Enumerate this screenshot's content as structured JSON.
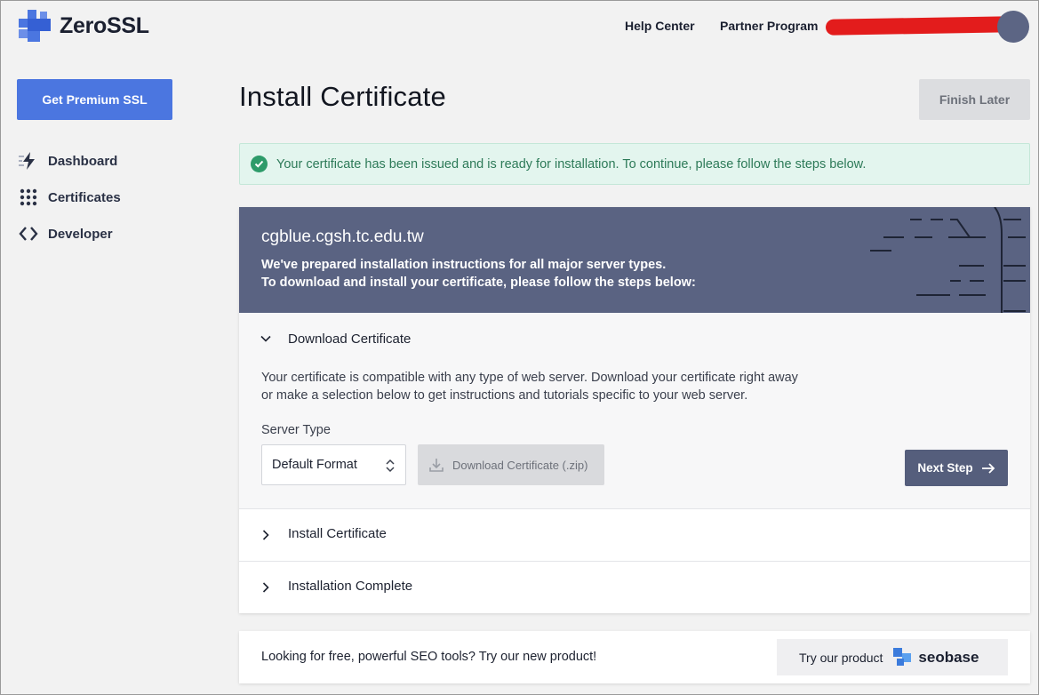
{
  "brand": {
    "name": "ZeroSSL",
    "logo_icon": "zerossl-cross-icon",
    "accent": "#4b76e0"
  },
  "header": {
    "links": [
      "Help Center",
      "Partner Program"
    ],
    "user_redacted": true
  },
  "sidebar": {
    "cta": "Get Premium SSL",
    "items": [
      {
        "label": "Dashboard",
        "icon": "lightning-icon"
      },
      {
        "label": "Certificates",
        "icon": "grid-dots-icon"
      },
      {
        "label": "Developer",
        "icon": "code-brackets-icon"
      }
    ]
  },
  "main": {
    "title": "Install Certificate",
    "finish_later": "Finish Later",
    "alert": {
      "text": "Your certificate has been issued and is ready for installation. To continue, please follow the steps below.",
      "color": "#2e9b6a"
    },
    "card": {
      "domain": "cgblue.cgsh.tc.edu.tw",
      "intro_line1": "We've prepared installation instructions for all major server types.",
      "intro_line2": "To download and install your certificate, please follow the steps below:",
      "steps": [
        {
          "label": "Download Certificate",
          "expanded": true,
          "description": "Your certificate is compatible with any type of web server. Download your certificate right away or make a selection below to get instructions and tutorials specific to your web server.",
          "server_type_label": "Server Type",
          "server_type_value": "Default Format",
          "download_button": "Download Certificate (.zip)",
          "next_button": "Next Step"
        },
        {
          "label": "Install Certificate",
          "expanded": false
        },
        {
          "label": "Installation Complete",
          "expanded": false
        }
      ]
    }
  },
  "promo": {
    "text": "Looking for free, powerful SEO tools? Try our new product!",
    "button_text": "Try our product",
    "product_name": "seobase"
  }
}
